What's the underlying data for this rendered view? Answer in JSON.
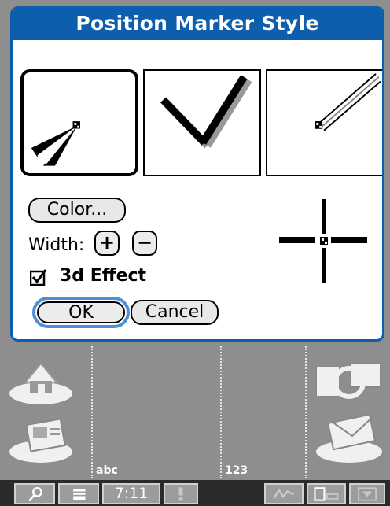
{
  "dialog": {
    "title": "Position Marker Style",
    "styles": [
      {
        "name": "arrow-style",
        "selected": true
      },
      {
        "name": "cross-tail-style",
        "selected": false
      },
      {
        "name": "double-line-style",
        "selected": false
      }
    ],
    "color_button": "Color...",
    "width_label": "Width:",
    "width_plus": "+",
    "width_minus": "−",
    "effect_label": "3d Effect",
    "effect_checked": true,
    "ok_label": "OK",
    "cancel_label": "Cancel"
  },
  "launcher": {
    "left_labels": [
      "abc"
    ],
    "right_labels": [
      "123"
    ],
    "icons": [
      "home-icon",
      "applications-icon",
      "sync-icon",
      "mail-icon"
    ]
  },
  "statusbar": {
    "time": "7:11",
    "icons": [
      "find-icon",
      "menu-icon",
      "alert-icon",
      "graffiti-icon",
      "screen-icon",
      "input-icon"
    ]
  }
}
